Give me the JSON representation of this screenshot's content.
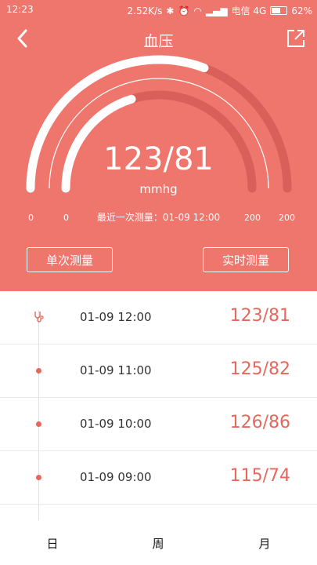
{
  "status_bar": {
    "time": "12:23",
    "net_speed": "2.52K/s",
    "carrier": "电信 4G",
    "battery": "62%"
  },
  "header": {
    "title": "血压",
    "back_icon": "chevron-left-icon",
    "share_icon": "share-external-icon"
  },
  "gauge": {
    "reading": "123/81",
    "unit": "mmhg",
    "last_measurement": "最近一次测量：01-09 12:00",
    "outer_min": "0",
    "outer_max": "200",
    "inner_min": "0",
    "inner_max": "200",
    "systolic": 123,
    "diastolic": 81,
    "scale_max": 200,
    "colors": {
      "background": "#ee766c",
      "track": "#d9605a",
      "fill": "#ffffff",
      "accent": "#e7675c"
    }
  },
  "buttons": {
    "single": "单次测量",
    "realtime": "实时测量"
  },
  "records": [
    {
      "time": "01-09 12:00",
      "value": "123/81",
      "icon": "stethoscope-icon"
    },
    {
      "time": "01-09 11:00",
      "value": "125/82",
      "icon": "dot"
    },
    {
      "time": "01-09 10:00",
      "value": "126/86",
      "icon": "dot"
    },
    {
      "time": "01-09 09:00",
      "value": "115/74",
      "icon": "dot"
    }
  ],
  "tabs": [
    "日",
    "周",
    "月"
  ]
}
